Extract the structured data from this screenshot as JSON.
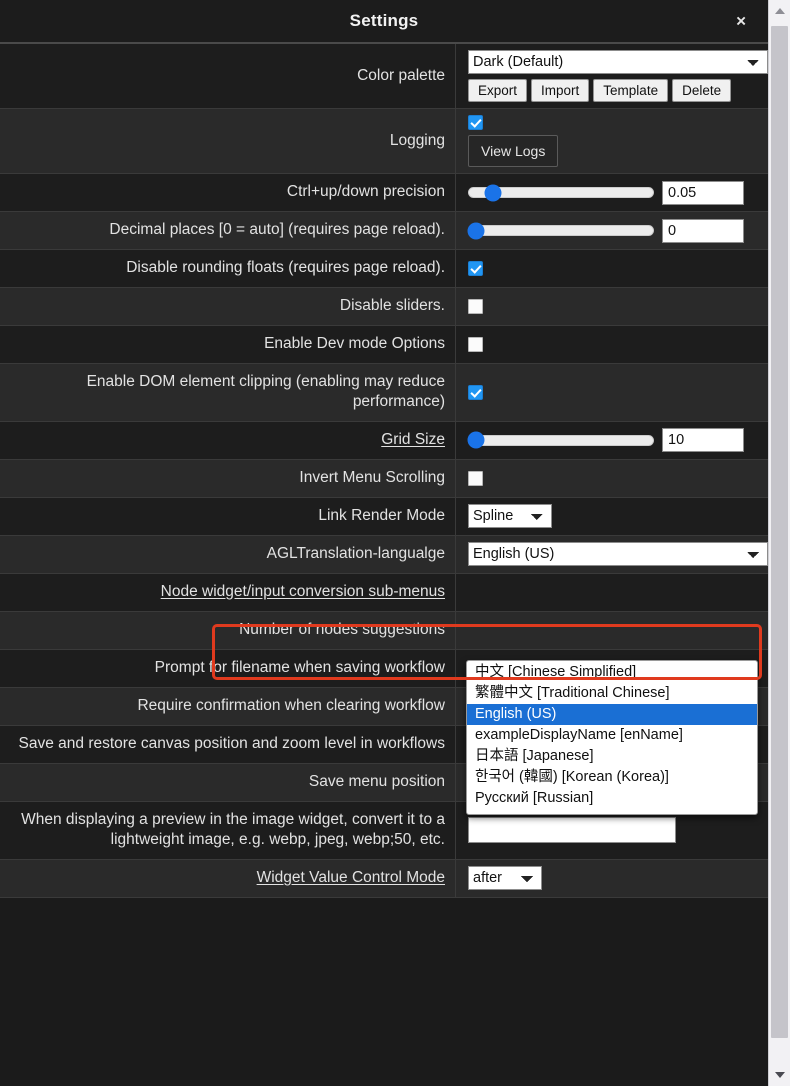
{
  "dialog": {
    "title": "Settings",
    "close_label": "×"
  },
  "scrollbar": {
    "up_arrow": "scroll-up-arrow",
    "down_arrow": "scroll-down-arrow"
  },
  "rows": [
    {
      "label": "Color palette",
      "type": "palette",
      "select_value": "Dark (Default)",
      "buttons": [
        "Export",
        "Import",
        "Template",
        "Delete"
      ]
    },
    {
      "label": "Logging",
      "type": "logging",
      "checked": true,
      "button": "View Logs"
    },
    {
      "label": "Ctrl+up/down precision",
      "type": "slider",
      "value": "0.05",
      "thumb_pct": 13
    },
    {
      "label": "Decimal places [0 = auto] (requires page reload).",
      "type": "slider",
      "value": "0",
      "thumb_pct": 4
    },
    {
      "label": "Disable rounding floats (requires page reload).",
      "type": "checkbox",
      "checked": true
    },
    {
      "label": "Disable sliders.",
      "type": "checkbox",
      "checked": false
    },
    {
      "label": "Enable Dev mode Options",
      "type": "checkbox",
      "checked": false
    },
    {
      "label": "Enable DOM element clipping (enabling may reduce performance)",
      "type": "checkbox",
      "checked": true
    },
    {
      "label": "Grid Size",
      "type": "slider",
      "value": "10",
      "thumb_pct": 4,
      "underline": true
    },
    {
      "label": "Invert Menu Scrolling",
      "type": "checkbox",
      "checked": false
    },
    {
      "label": "Link Render Mode",
      "type": "select-narrow",
      "select_value": "Spline"
    },
    {
      "label": "AGLTranslation-langualge",
      "type": "select-wide",
      "select_value": "English (US)"
    },
    {
      "label": "Node widget/input conversion sub-menus",
      "type": "empty",
      "underline": true
    },
    {
      "label": "Number of nodes suggestions",
      "type": "empty"
    },
    {
      "label": "Prompt for filename when saving workflow",
      "type": "empty"
    },
    {
      "label": "Require confirmation when clearing workflow",
      "type": "checkbox",
      "checked": true
    },
    {
      "label": "Save and restore canvas position and zoom level in workflows",
      "type": "checkbox",
      "checked": true
    },
    {
      "label": "Save menu position",
      "type": "checkbox",
      "checked": false
    },
    {
      "label": "When displaying a preview in the image widget, convert it to a lightweight image, e.g. webp, jpeg, webp;50, etc.",
      "type": "text",
      "value": "",
      "placeholder": ""
    },
    {
      "label": "Widget Value Control Mode",
      "type": "select-tiny",
      "select_value": "after",
      "underline": true
    }
  ],
  "language_dropdown": {
    "selected": "English (US)",
    "options": [
      "中文 [Chinese Simplified]",
      "繁體中文 [Traditional Chinese]",
      "English (US)",
      "exampleDisplayName [enName]",
      "日本語 [Japanese]",
      "한국어 (韓國) [Korean (Korea)]",
      "Русский [Russian]"
    ]
  },
  "highlight": {
    "color": "#e03a1e",
    "target": "AGLTranslation-langualge"
  }
}
